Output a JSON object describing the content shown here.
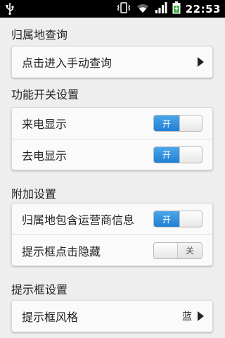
{
  "status_bar": {
    "time": "22:53",
    "icons": [
      "usb-icon",
      "vibrate-icon",
      "wifi-icon",
      "signal-icon",
      "battery-charging-icon"
    ]
  },
  "sections": [
    {
      "header": "归属地查询",
      "rows": [
        {
          "label": "点击进入手动查询",
          "control": "arrow"
        }
      ]
    },
    {
      "header": "功能开关设置",
      "rows": [
        {
          "label": "来电显示",
          "control": "toggle",
          "state": "on",
          "toggle_text": "开"
        },
        {
          "label": "去电显示",
          "control": "toggle",
          "state": "on",
          "toggle_text": "开"
        }
      ]
    },
    {
      "header": "附加设置",
      "rows": [
        {
          "label": "归属地包含运营商信息",
          "control": "toggle",
          "state": "on",
          "toggle_text": "开"
        },
        {
          "label": "提示框点击隐藏",
          "control": "toggle",
          "state": "off",
          "toggle_text": "关"
        }
      ]
    },
    {
      "header": "提示框设置",
      "rows": [
        {
          "label": "提示框风格",
          "control": "arrow",
          "value": "蓝"
        }
      ]
    }
  ],
  "colors": {
    "toggle_on": "#2b8ae0",
    "background": "#eeeeee",
    "card": "#fafafa",
    "statusbar": "#000000"
  }
}
